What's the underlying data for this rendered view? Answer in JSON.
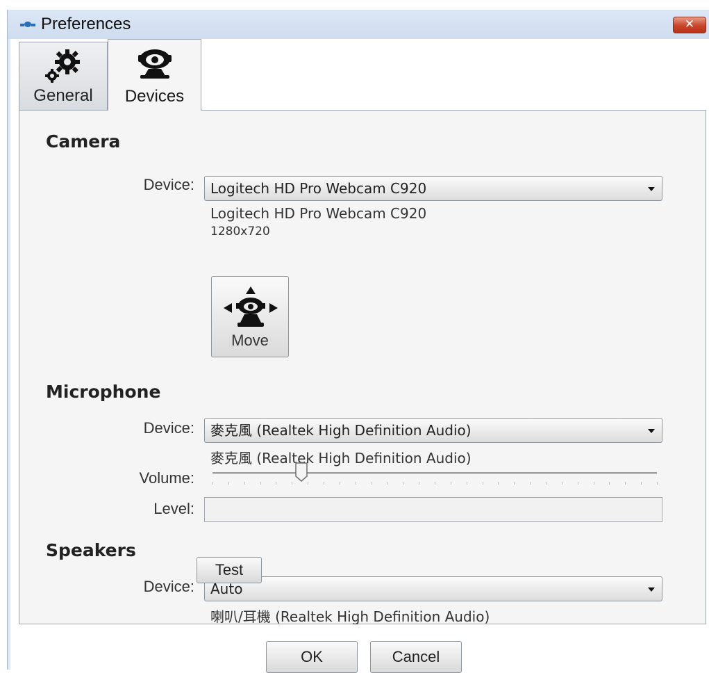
{
  "window": {
    "title": "Preferences",
    "close_symbol": "✕",
    "app_icon": "preferences-app-icon"
  },
  "tabs": [
    {
      "label": "General",
      "icon": "gears-icon",
      "selected": false
    },
    {
      "label": "Devices",
      "icon": "webcam-icon",
      "selected": true
    }
  ],
  "camera": {
    "section_title": "Camera",
    "device_label": "Device:",
    "device_value": "Logitech HD Pro Webcam C920",
    "info_name": "Logitech HD Pro Webcam C920",
    "info_resolution": "1280x720",
    "move_label": "Move",
    "move_icon": "move-camera-icon"
  },
  "microphone": {
    "section_title": "Microphone",
    "device_label": "Device:",
    "device_value": "麥克風 (Realtek High Definition Audio)",
    "info_name": "麥克風 (Realtek High Definition Audio)",
    "volume_label": "Volume:",
    "volume_fraction": 0.2,
    "level_label": "Level:",
    "level_fraction": 0
  },
  "speakers": {
    "section_title": "Speakers",
    "device_label": "Device:",
    "device_value": "Auto",
    "info_name": "喇叭/耳機 (Realtek High Definition Audio)",
    "test_label": "Test"
  },
  "footer": {
    "ok_label": "OK",
    "cancel_label": "Cancel"
  },
  "colors": {
    "titlebar": "#cfdcee",
    "close_button": "#c8452b",
    "panel_background": "#f5f5f5"
  }
}
